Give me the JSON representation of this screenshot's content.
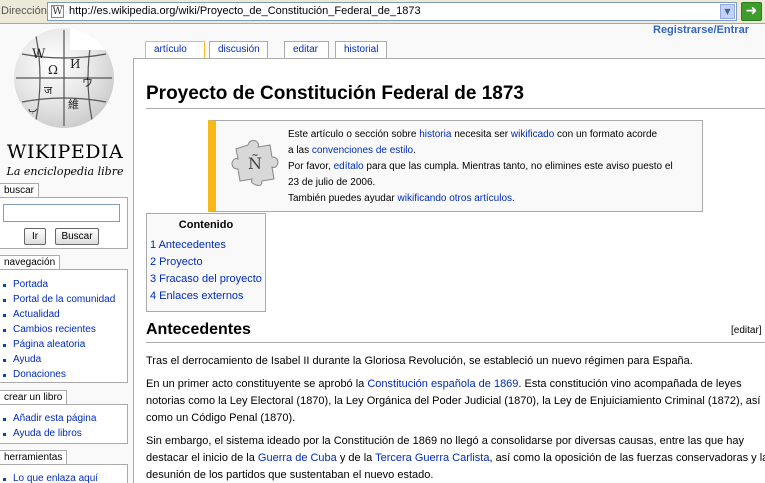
{
  "browser": {
    "address_label": "Dirección",
    "url": "http://es.wikipedia.org/wiki/Proyecto_de_Constitución_Federal_de_1873",
    "go_symbol": "➜"
  },
  "logo": {
    "wordmark": "WIKIPEDIA",
    "tagline": "La enciclopedia libre"
  },
  "user": {
    "login": "Registrarse/Entrar"
  },
  "tabs": [
    {
      "label": "artículo",
      "selected": true
    },
    {
      "label": "discusión"
    },
    {
      "label": "editar"
    },
    {
      "label": "historial"
    }
  ],
  "search": {
    "heading": "buscar",
    "go": "Ir",
    "search": "Buscar"
  },
  "navigation": {
    "heading": "navegación",
    "items": [
      "Portada",
      "Portal de la comunidad",
      "Actualidad",
      "Cambios recientes",
      "Página aleatoria",
      "Ayuda",
      "Donaciones"
    ]
  },
  "create_book": {
    "heading": "crear un libro",
    "items": [
      "Añadir esta página",
      "Ayuda de libros"
    ]
  },
  "tools": {
    "heading": "herramientas",
    "items": [
      "Lo que enlaza aquí"
    ]
  },
  "article": {
    "title": "Proyecto de Constitución Federal de 1873",
    "notice": {
      "l1a": "Este artículo o sección sobre ",
      "l1b": "historia",
      "l1c": " necesita ser ",
      "l1d": "wikificado",
      "l1e": " con un formato acorde",
      "l2a": "a las ",
      "l2b": "convenciones de estilo",
      "l2c": ".",
      "l3a": "Por favor, ",
      "l3b": "edítalo",
      "l3c": " para que las cumpla. Mientras tanto, no elimines este aviso puesto el",
      "l4": "23 de julio de 2006.",
      "l5a": "También puedes ayudar ",
      "l5b": "wikificando otros artículos",
      "l5c": "."
    },
    "toc": {
      "title": "Contenido",
      "items": [
        "1 Antecedentes",
        "2 Proyecto",
        "3 Fracaso del proyecto",
        "4 Enlaces externos"
      ]
    },
    "section1": {
      "heading": "Antecedentes",
      "edit": "[editar]",
      "p1": "Tras el derrocamiento de Isabel II durante la Gloriosa Revolución, se estableció un nuevo régimen para España.",
      "p2a": "En un primer acto constituyente se aprobó la ",
      "p2b": "Constitución española de 1869",
      "p2c": ". Esta constitución vino acompañada de leyes",
      "p2d": "notorias como la Ley Electoral (1870), la Ley Orgánica del Poder Judicial (1870), la Ley de Enjuiciamiento Criminal (1872), así",
      "p2e": "como un Código Penal (1870).",
      "p3a": "Sin embargo, el sistema ideado por la Constitución de 1869 no llegó a consolidarse por diversas causas, entre las que hay",
      "p3b": "destacar el inicio de la ",
      "p3c": "Guerra de Cuba",
      "p3d": " y de la ",
      "p3e": "Tercera Guerra Carlista",
      "p3f": ", así como la oposición de las fuerzas conservadoras y la",
      "p3g": "desunión de los partidos que sustentaban el nuevo estado."
    }
  }
}
